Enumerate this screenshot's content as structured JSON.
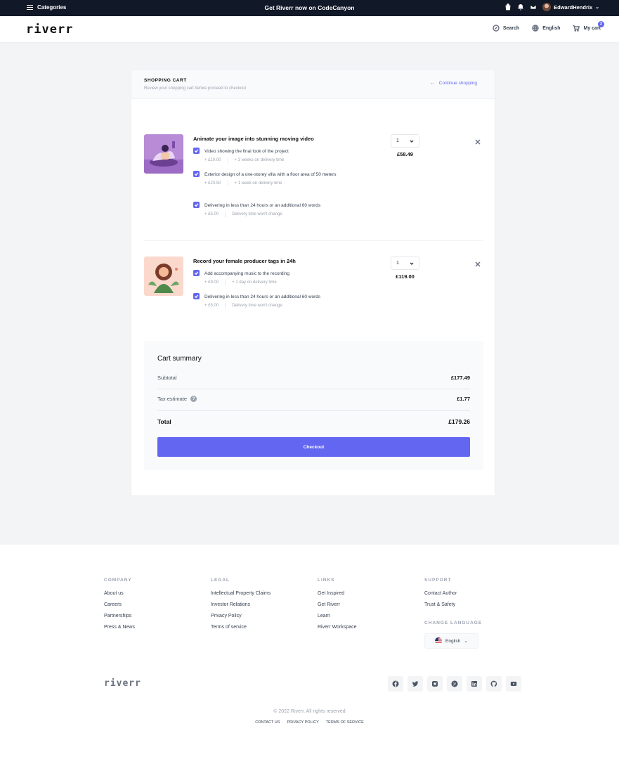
{
  "topbar": {
    "categories_label": "Categories",
    "promo": "Get Riverr now on CodeCanyon",
    "username": "EdwardHendrix"
  },
  "header": {
    "logo": "riverr",
    "search_label": "Search",
    "language_label": "English",
    "cart_label": "My cart",
    "cart_count": "2"
  },
  "cart": {
    "title": "SHOPPING CART",
    "subtitle": "Review your shopping cart before proceed to checkout",
    "continue_label": "Continue shopping",
    "items": [
      {
        "title": "Animate your image into stunning moving video",
        "quantity": "1",
        "price": "£58.49",
        "options": [
          {
            "name": "Video showing the final look of the project",
            "price": "+ £10.00",
            "delivery": "+ 3 weeks on delivery time"
          },
          {
            "name": "Exterior design of a one-storey villa with a floor area of 50 meters",
            "price": "+ £23.50",
            "delivery": "+ 1 week on delivery time"
          },
          {
            "name": "Delivering in less than 24 hours or an additional 60 words",
            "price": "+ £5.00",
            "delivery": "Delivery time won't change"
          }
        ]
      },
      {
        "title": "Record your female producer tags in 24h",
        "quantity": "1",
        "price": "£119.00",
        "options": [
          {
            "name": "Add accompanying music to the recording",
            "price": "+ £9.00",
            "delivery": "+ 1 day on delivery time"
          },
          {
            "name": "Delivering in less than 24 hours or an additional 60 words",
            "price": "+ £5.00",
            "delivery": "Delivery time won't change"
          }
        ]
      }
    ]
  },
  "summary": {
    "title": "Cart summary",
    "subtotal_label": "Subtotal",
    "subtotal_value": "£177.49",
    "tax_label": "Tax estimate",
    "tax_help": "?",
    "tax_value": "£1.77",
    "total_label": "Total",
    "total_value": "£179.26",
    "checkout_label": "Checkout"
  },
  "footer": {
    "columns": [
      {
        "heading": "COMPANY",
        "links": [
          "About us",
          "Careers",
          "Partnerships",
          "Press & News"
        ]
      },
      {
        "heading": "LEGAL",
        "links": [
          "Intellectual Property Claims",
          "Investor Relations",
          "Privacy Policy",
          "Terms of service"
        ]
      },
      {
        "heading": "LINKS",
        "links": [
          "Get Inspired",
          "Get Riverr",
          "Learn",
          "Riverr Workspace"
        ]
      },
      {
        "heading": "SUPPORT",
        "links": [
          "Contact Author",
          "Trust & Safety"
        ]
      }
    ],
    "change_language_heading": "CHANGE LANGUAGE",
    "language_value": "English",
    "logo": "riverr",
    "socials": [
      "facebook-icon",
      "twitter-icon",
      "instagram-icon",
      "pinterest-icon",
      "linkedin-icon",
      "github-icon",
      "youtube-icon"
    ],
    "copyright": "© 2022 Riverr. All rights reserved",
    "bottom_links": [
      "CONTACT US",
      "PRIVACY POLICY",
      "TERMS OF SERVICE"
    ]
  },
  "colors": {
    "accent": "#6366f1",
    "topbar": "#111827"
  }
}
